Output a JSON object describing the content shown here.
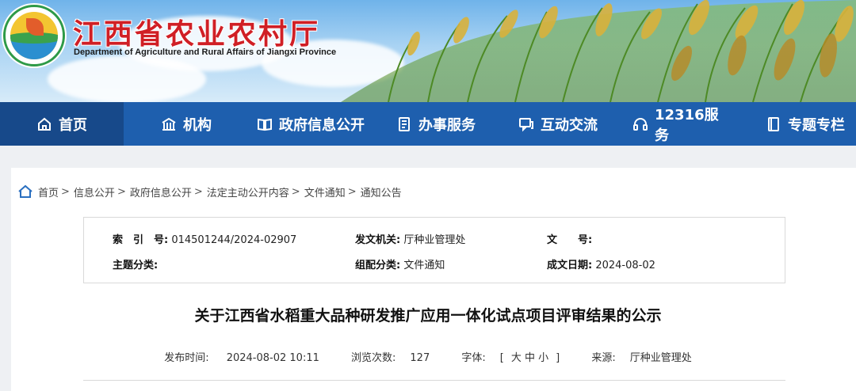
{
  "header": {
    "title": "江西省农业农村厅",
    "subtitle": "Department of Agriculture and Rural Affairs of Jiangxi Province",
    "colors": {
      "title": "#d01f25",
      "nav_bg": "#1e5fae",
      "nav_active": "#17498a"
    }
  },
  "nav": {
    "items": [
      {
        "label": "首页",
        "icon": "home-icon"
      },
      {
        "label": "机构",
        "icon": "building-icon"
      },
      {
        "label": "政府信息公开",
        "icon": "book-icon"
      },
      {
        "label": "办事服务",
        "icon": "document-icon"
      },
      {
        "label": "互动交流",
        "icon": "chat-icon"
      },
      {
        "label": "12316服务",
        "icon": "headset-icon"
      },
      {
        "label": "专题专栏",
        "icon": "notebook-icon"
      }
    ],
    "active_index": 0
  },
  "breadcrumb": [
    "首页",
    "信息公开",
    "政府信息公开",
    "法定主动公开内容",
    "文件通知",
    "通知公告"
  ],
  "meta": {
    "index_label": "索　引　号:",
    "index_value": "014501244/2024-02907",
    "issuer_label": "发文机关:",
    "issuer_value": "厅种业管理处",
    "docno_label": "文　　号:",
    "docno_value": "",
    "topic_label": "主题分类:",
    "topic_value": "",
    "category_label": "组配分类:",
    "category_value": "文件通知",
    "date_label": "成文日期:",
    "date_value": "2024-08-02"
  },
  "article": {
    "title": "关于江西省水稻重大品种研发推广应用一体化试点项目评审结果的公示",
    "publish_label": "发布时间:",
    "publish_value": "2024-08-02 10:11",
    "views_label": "浏览次数:",
    "views_value": "127",
    "font_label": "字体:",
    "font_open": "[",
    "font_large": "大",
    "font_medium": "中",
    "font_small": "小",
    "font_close": "]",
    "source_label": "来源:",
    "source_value": "厅种业管理处"
  }
}
